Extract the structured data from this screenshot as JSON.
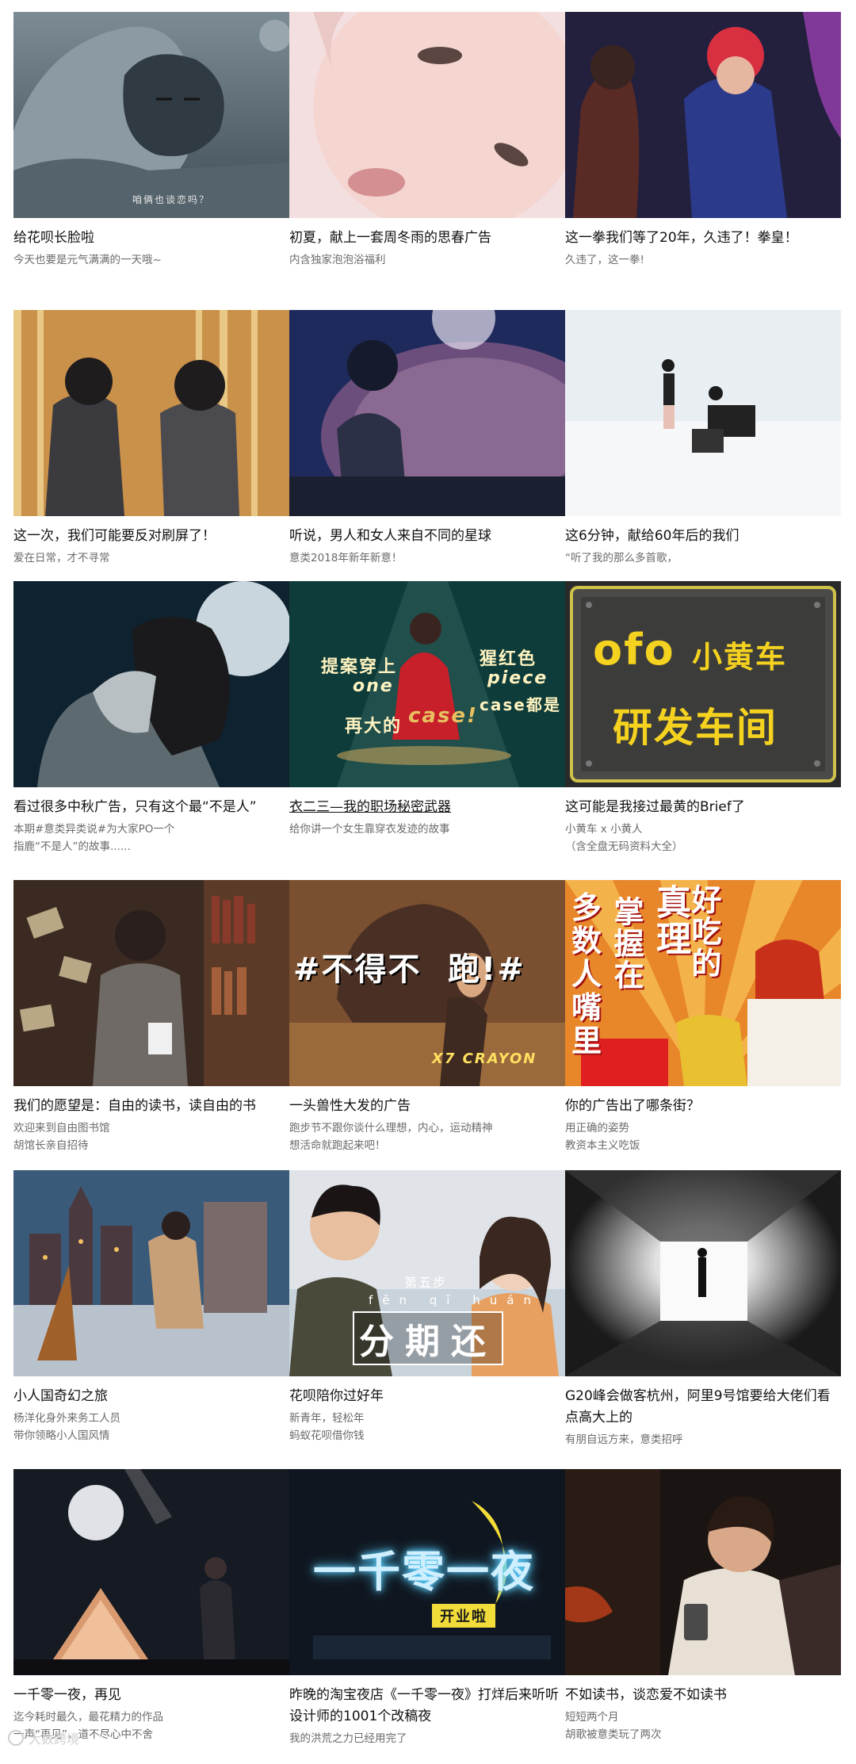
{
  "rows": [
    [
      {
        "title": "给花呗长脸啦",
        "sub": [
          "今天也要是元气满满的一天哦~"
        ],
        "thumb_text": "咱俩也谈恋吗？"
      },
      {
        "title": "初夏，献上一套周冬雨的思春广告",
        "sub": [
          "内含独家泡泡浴福利"
        ]
      },
      {
        "title": "这一拳我们等了20年，久违了！拳皇！",
        "sub": [
          "久违了，这一拳!"
        ]
      }
    ],
    [
      {
        "title": "这一次，我们可能要反对刷屏了！",
        "sub": [
          "爱在日常，才不寻常"
        ]
      },
      {
        "title": "听说，男人和女人来自不同的星球",
        "sub": [
          "意类2018年新年新意！"
        ]
      },
      {
        "title": "这6分钟，献给60年后的我们",
        "sub": [
          "“听了我的那么多首歌，"
        ]
      }
    ],
    [
      {
        "title": "看过很多中秋广告，只有这个最“不是人”",
        "sub": [
          "本期#意类异类说#为大家PO一个",
          "指鹿“不是人”的故事......"
        ]
      },
      {
        "title": "衣二三—我的职场秘密武器",
        "sub": [
          "给你讲一个女生靠穿衣发迹的故事"
        ],
        "thumb_text": [
          "提案穿上",
          "one",
          "piece",
          "猩红色",
          "再大的",
          "case!",
          "case都是"
        ]
      },
      {
        "title": "这可能是我接过最黄的Brief了",
        "sub": [
          "小黄车 x 小黄人",
          "（含全盘无码资料大全）"
        ],
        "thumb_text": [
          "ofo",
          "小黄车",
          "研发车间"
        ]
      }
    ],
    [
      {
        "title": "我们的愿望是：自由的读书，读自由的书",
        "sub": [
          "欢迎来到自由图书馆",
          "胡馆长亲自招待"
        ]
      },
      {
        "title": "一头兽性大发的广告",
        "sub": [
          "跑步节不跟你谈什么理想，内心，运动精神",
          "想活命就跑起来吧！"
        ],
        "thumb_text": [
          "#不得不",
          "跑!#",
          "X7 CRAYON"
        ]
      },
      {
        "title": "你的广告出了哪条街？",
        "sub": [
          "用正确的姿势",
          "教资本主义吃饭"
        ],
        "thumb_text": [
          "多",
          "数",
          "人",
          "嘴",
          "里",
          "掌握在",
          "真理",
          "好吃的"
        ]
      }
    ],
    [
      {
        "title": "小人国奇幻之旅",
        "sub": [
          "杨洋化身外来务工人员",
          "带你领略小人国风情"
        ]
      },
      {
        "title": "花呗陪你过好年",
        "sub": [
          "新青年，轻松年",
          "蚂蚁花呗借你钱"
        ],
        "thumb_text": [
          "第五步",
          "fēn qī huán",
          "分期还"
        ]
      },
      {
        "title": "G20峰会做客杭州，阿里9号馆要给大佬们看点高大上的",
        "sub": [
          "有朋自远方来，意类招呼"
        ]
      }
    ],
    [
      {
        "title": "一千零一夜，再见",
        "sub": [
          "迄今耗时最久，最花精力的作品",
          "一声“再见”，道不尽心中不舍"
        ]
      },
      {
        "title": "昨晚的淘宝夜店《一千零一夜》打烊后来听听设计师的1001个改稿夜",
        "sub": [
          "我的洪荒之力已经用完了"
        ],
        "thumb_text": [
          "一千零一夜",
          "开业啦"
        ]
      },
      {
        "title": "不如读书，谈恋爱不如读书",
        "sub": [
          "短短两个月",
          "胡歌被意类玩了两次"
        ]
      }
    ]
  ],
  "watermark": "大数跨境"
}
